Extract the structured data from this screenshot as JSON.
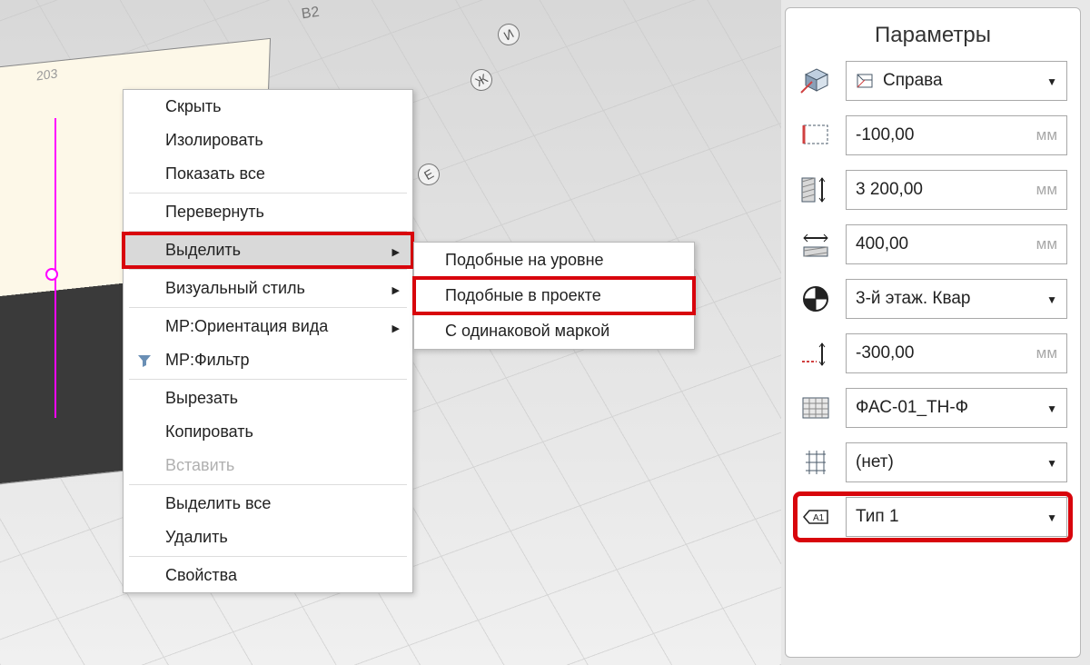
{
  "viewport": {
    "axis_labels": [
      "И",
      "Ж",
      "Е"
    ],
    "marker_text": "B2",
    "room_text": "203"
  },
  "context_menu": {
    "items": [
      {
        "label": "Скрыть",
        "arrow": false
      },
      {
        "label": "Изолировать",
        "arrow": false
      },
      {
        "label": "Показать все",
        "arrow": false
      },
      {
        "label": "Перевернуть",
        "arrow": false,
        "sep_before": true
      },
      {
        "label": "Выделить",
        "arrow": true,
        "highlight": true,
        "sep_before": true
      },
      {
        "label": "Визуальный стиль",
        "arrow": true,
        "sep_before": true
      },
      {
        "label": "MP:Ориентация вида",
        "arrow": true,
        "sep_before": true
      },
      {
        "label": "MP:Фильтр",
        "arrow": false,
        "icon": "filter"
      },
      {
        "label": "Вырезать",
        "arrow": false,
        "sep_before": true
      },
      {
        "label": "Копировать",
        "arrow": false
      },
      {
        "label": "Вставить",
        "arrow": false,
        "disabled": true
      },
      {
        "label": "Выделить все",
        "arrow": false,
        "sep_before": true
      },
      {
        "label": "Удалить",
        "arrow": false
      },
      {
        "label": "Свойства",
        "arrow": false,
        "sep_before": true
      }
    ]
  },
  "submenu": {
    "items": [
      {
        "label": "Подобные на уровне"
      },
      {
        "label": "Подобные в проекте",
        "highlight": true
      },
      {
        "label": "С одинаковой маркой"
      }
    ]
  },
  "properties": {
    "title": "Параметры",
    "rows": [
      {
        "icon": "cube-side",
        "value": "Справа",
        "kind": "dropdown"
      },
      {
        "icon": "offset-top",
        "value": "-100,00",
        "kind": "number",
        "unit": "мм"
      },
      {
        "icon": "hatch-height",
        "value": "3 200,00",
        "kind": "number",
        "unit": "мм"
      },
      {
        "icon": "width",
        "value": "400,00",
        "kind": "number",
        "unit": "мм"
      },
      {
        "icon": "level",
        "value": "3-й этаж. Квар",
        "kind": "dropdown"
      },
      {
        "icon": "offset-base",
        "value": "-300,00",
        "kind": "number",
        "unit": "мм"
      },
      {
        "icon": "hatch-pattern",
        "value": "ФАС-01_ТН-Ф",
        "kind": "dropdown"
      },
      {
        "icon": "grid",
        "value": "(нет)",
        "kind": "dropdown"
      },
      {
        "icon": "tag",
        "value": "Тип 1",
        "kind": "dropdown",
        "highlight": true
      }
    ]
  }
}
